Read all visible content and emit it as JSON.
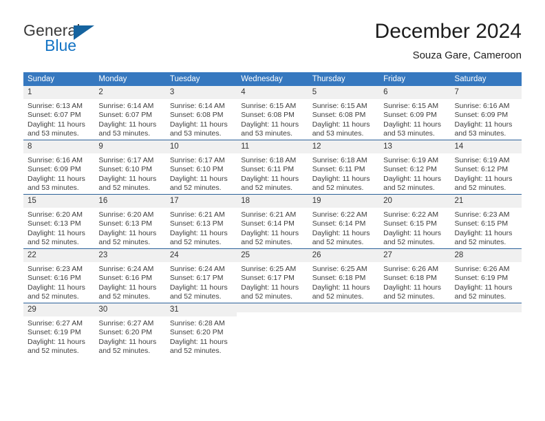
{
  "brand": {
    "name_top": "General",
    "name_bottom": "Blue",
    "color_dark": "#3a3a3a",
    "color_blue": "#1373c4",
    "triangle_color": "#15639f"
  },
  "header": {
    "title": "December 2024",
    "location": "Souza Gare, Cameroon"
  },
  "theme": {
    "header_row_bg": "#3678bf",
    "header_row_text": "#ffffff",
    "row_separator": "#2a6099",
    "daynum_bg": "#f0f0f0",
    "body_text": "#3d3d3d"
  },
  "weekdays": [
    "Sunday",
    "Monday",
    "Tuesday",
    "Wednesday",
    "Thursday",
    "Friday",
    "Saturday"
  ],
  "weeks": [
    [
      {
        "day": "1",
        "sunrise": "Sunrise: 6:13 AM",
        "sunset": "Sunset: 6:07 PM",
        "daylight": "Daylight: 11 hours and 53 minutes."
      },
      {
        "day": "2",
        "sunrise": "Sunrise: 6:14 AM",
        "sunset": "Sunset: 6:07 PM",
        "daylight": "Daylight: 11 hours and 53 minutes."
      },
      {
        "day": "3",
        "sunrise": "Sunrise: 6:14 AM",
        "sunset": "Sunset: 6:08 PM",
        "daylight": "Daylight: 11 hours and 53 minutes."
      },
      {
        "day": "4",
        "sunrise": "Sunrise: 6:15 AM",
        "sunset": "Sunset: 6:08 PM",
        "daylight": "Daylight: 11 hours and 53 minutes."
      },
      {
        "day": "5",
        "sunrise": "Sunrise: 6:15 AM",
        "sunset": "Sunset: 6:08 PM",
        "daylight": "Daylight: 11 hours and 53 minutes."
      },
      {
        "day": "6",
        "sunrise": "Sunrise: 6:15 AM",
        "sunset": "Sunset: 6:09 PM",
        "daylight": "Daylight: 11 hours and 53 minutes."
      },
      {
        "day": "7",
        "sunrise": "Sunrise: 6:16 AM",
        "sunset": "Sunset: 6:09 PM",
        "daylight": "Daylight: 11 hours and 53 minutes."
      }
    ],
    [
      {
        "day": "8",
        "sunrise": "Sunrise: 6:16 AM",
        "sunset": "Sunset: 6:09 PM",
        "daylight": "Daylight: 11 hours and 53 minutes."
      },
      {
        "day": "9",
        "sunrise": "Sunrise: 6:17 AM",
        "sunset": "Sunset: 6:10 PM",
        "daylight": "Daylight: 11 hours and 52 minutes."
      },
      {
        "day": "10",
        "sunrise": "Sunrise: 6:17 AM",
        "sunset": "Sunset: 6:10 PM",
        "daylight": "Daylight: 11 hours and 52 minutes."
      },
      {
        "day": "11",
        "sunrise": "Sunrise: 6:18 AM",
        "sunset": "Sunset: 6:11 PM",
        "daylight": "Daylight: 11 hours and 52 minutes."
      },
      {
        "day": "12",
        "sunrise": "Sunrise: 6:18 AM",
        "sunset": "Sunset: 6:11 PM",
        "daylight": "Daylight: 11 hours and 52 minutes."
      },
      {
        "day": "13",
        "sunrise": "Sunrise: 6:19 AM",
        "sunset": "Sunset: 6:12 PM",
        "daylight": "Daylight: 11 hours and 52 minutes."
      },
      {
        "day": "14",
        "sunrise": "Sunrise: 6:19 AM",
        "sunset": "Sunset: 6:12 PM",
        "daylight": "Daylight: 11 hours and 52 minutes."
      }
    ],
    [
      {
        "day": "15",
        "sunrise": "Sunrise: 6:20 AM",
        "sunset": "Sunset: 6:13 PM",
        "daylight": "Daylight: 11 hours and 52 minutes."
      },
      {
        "day": "16",
        "sunrise": "Sunrise: 6:20 AM",
        "sunset": "Sunset: 6:13 PM",
        "daylight": "Daylight: 11 hours and 52 minutes."
      },
      {
        "day": "17",
        "sunrise": "Sunrise: 6:21 AM",
        "sunset": "Sunset: 6:13 PM",
        "daylight": "Daylight: 11 hours and 52 minutes."
      },
      {
        "day": "18",
        "sunrise": "Sunrise: 6:21 AM",
        "sunset": "Sunset: 6:14 PM",
        "daylight": "Daylight: 11 hours and 52 minutes."
      },
      {
        "day": "19",
        "sunrise": "Sunrise: 6:22 AM",
        "sunset": "Sunset: 6:14 PM",
        "daylight": "Daylight: 11 hours and 52 minutes."
      },
      {
        "day": "20",
        "sunrise": "Sunrise: 6:22 AM",
        "sunset": "Sunset: 6:15 PM",
        "daylight": "Daylight: 11 hours and 52 minutes."
      },
      {
        "day": "21",
        "sunrise": "Sunrise: 6:23 AM",
        "sunset": "Sunset: 6:15 PM",
        "daylight": "Daylight: 11 hours and 52 minutes."
      }
    ],
    [
      {
        "day": "22",
        "sunrise": "Sunrise: 6:23 AM",
        "sunset": "Sunset: 6:16 PM",
        "daylight": "Daylight: 11 hours and 52 minutes."
      },
      {
        "day": "23",
        "sunrise": "Sunrise: 6:24 AM",
        "sunset": "Sunset: 6:16 PM",
        "daylight": "Daylight: 11 hours and 52 minutes."
      },
      {
        "day": "24",
        "sunrise": "Sunrise: 6:24 AM",
        "sunset": "Sunset: 6:17 PM",
        "daylight": "Daylight: 11 hours and 52 minutes."
      },
      {
        "day": "25",
        "sunrise": "Sunrise: 6:25 AM",
        "sunset": "Sunset: 6:17 PM",
        "daylight": "Daylight: 11 hours and 52 minutes."
      },
      {
        "day": "26",
        "sunrise": "Sunrise: 6:25 AM",
        "sunset": "Sunset: 6:18 PM",
        "daylight": "Daylight: 11 hours and 52 minutes."
      },
      {
        "day": "27",
        "sunrise": "Sunrise: 6:26 AM",
        "sunset": "Sunset: 6:18 PM",
        "daylight": "Daylight: 11 hours and 52 minutes."
      },
      {
        "day": "28",
        "sunrise": "Sunrise: 6:26 AM",
        "sunset": "Sunset: 6:19 PM",
        "daylight": "Daylight: 11 hours and 52 minutes."
      }
    ],
    [
      {
        "day": "29",
        "sunrise": "Sunrise: 6:27 AM",
        "sunset": "Sunset: 6:19 PM",
        "daylight": "Daylight: 11 hours and 52 minutes."
      },
      {
        "day": "30",
        "sunrise": "Sunrise: 6:27 AM",
        "sunset": "Sunset: 6:20 PM",
        "daylight": "Daylight: 11 hours and 52 minutes."
      },
      {
        "day": "31",
        "sunrise": "Sunrise: 6:28 AM",
        "sunset": "Sunset: 6:20 PM",
        "daylight": "Daylight: 11 hours and 52 minutes."
      },
      {
        "day": "",
        "sunrise": "",
        "sunset": "",
        "daylight": ""
      },
      {
        "day": "",
        "sunrise": "",
        "sunset": "",
        "daylight": ""
      },
      {
        "day": "",
        "sunrise": "",
        "sunset": "",
        "daylight": ""
      },
      {
        "day": "",
        "sunrise": "",
        "sunset": "",
        "daylight": ""
      }
    ]
  ]
}
